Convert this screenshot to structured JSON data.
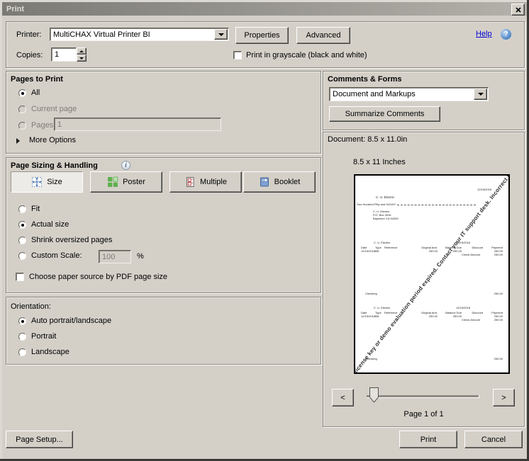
{
  "window": {
    "title": "Print"
  },
  "icons": {
    "close": "x-shape",
    "help": "?",
    "info": "i",
    "dropdown": "black-down-triangle",
    "spinner": "up-down-triangles",
    "more_options": "right-triangle",
    "prev": "<",
    "next": ">"
  },
  "colors": {
    "dialog_bg": "#d4d0c8",
    "titlebar_left": "#7b7a75",
    "titlebar_right": "#b4b1aa",
    "link_blue": "#0000d6",
    "selected_toggle_bg": "#ecebe7"
  },
  "top": {
    "printer_label": "Printer:",
    "printer_value": "MultiCHAX Virtual Printer BI",
    "properties_button": "Properties",
    "advanced_button": "Advanced",
    "help_link": "Help",
    "copies_label": "Copies:",
    "copies_value": "1",
    "grayscale_label": "Print in grayscale (black and white)"
  },
  "pages": {
    "title": "Pages to Print",
    "all": "All",
    "current_page": "Current page",
    "pages": "Pages",
    "pages_value": "1",
    "more_options": "More Options"
  },
  "sizing": {
    "title": "Page Sizing & Handling",
    "size": "Size",
    "poster": "Poster",
    "multiple": "Multiple",
    "booklet": "Booklet",
    "fit": "Fit",
    "actual_size": "Actual size",
    "shrink": "Shrink oversized pages",
    "custom_scale": "Custom Scale:",
    "custom_scale_value": "100",
    "percent": "%",
    "paper_source": "Choose paper source by PDF page size"
  },
  "orientation": {
    "title": "Orientation:",
    "auto": "Auto portrait/landscape",
    "portrait": "Portrait",
    "landscape": "Landscape"
  },
  "comments": {
    "title": "Comments & Forms",
    "dropdown_value": "Document and Markups",
    "summarize": "Summarize Comments"
  },
  "preview": {
    "document_size_label": "Document: 8.5 x 11.0in",
    "paper_size_label": "8.5 x 11 Inches",
    "page_indicator": "Page 1 of 1",
    "prev_glyph": "<",
    "next_glyph": ">",
    "watermark_text": "Incorrect license key or demo evaluation period expired.  Contact your IT support desk.  Incorrect license ke",
    "check": {
      "date": "12/15/2018",
      "payee": "C. U. Electric",
      "amount_words": "Two Hundred Fifty and 00/100*",
      "address_line1": "C. U. Electric",
      "address_line2": "P.O. Box 2616",
      "address_line3": "Bayshore CA 94326"
    },
    "stub_columns": {
      "date": "Date",
      "type": "Type",
      "reference": "Reference",
      "original_amt": "Original Amt.",
      "balance_due": "Balance Due",
      "discount": "Discount",
      "payment": "Payment"
    },
    "stubs": [
      {
        "company": "C. U. Electric",
        "date": "12/15/2018",
        "row_date": "12/15/2018",
        "row_type": "Bill",
        "original_amt": "250.00",
        "balance_due": "250.00",
        "payment": "250.00",
        "check_amount_label": "Check Amount",
        "check_amount": "250.00",
        "account": "Checking",
        "account_amount": "250.00"
      },
      {
        "company": "C. U. Electric",
        "date": "12/15/2018",
        "row_date": "12/15/2018",
        "row_type": "Bill",
        "original_amt": "250.00",
        "balance_due": "250.00",
        "payment": "250.00",
        "check_amount_label": "Check Amount",
        "check_amount": "250.00",
        "account": "Checking",
        "account_amount": "250.00"
      }
    ]
  },
  "footer": {
    "page_setup": "Page Setup...",
    "print": "Print",
    "cancel": "Cancel"
  }
}
